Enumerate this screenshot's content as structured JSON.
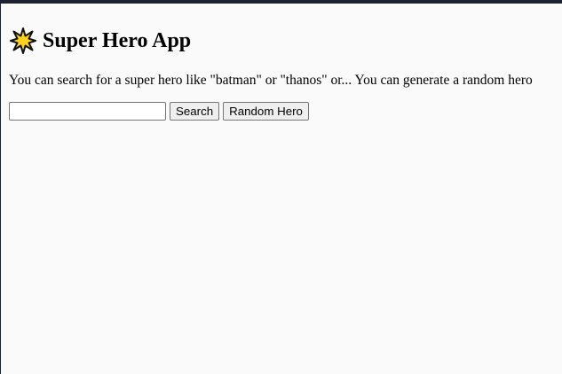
{
  "header": {
    "icon": "star-icon",
    "title": "Super Hero App"
  },
  "intro_text": "You can search for a super hero like \"batman\" or \"thanos\" or... You can generate a random hero",
  "search": {
    "value": "",
    "button_label": "Search"
  },
  "random_button_label": "Random Hero",
  "colors": {
    "top_bar": "#1b2230",
    "page_background": "#fafafa",
    "star_fill": "#ffd21f",
    "button_background": "#efefef"
  }
}
